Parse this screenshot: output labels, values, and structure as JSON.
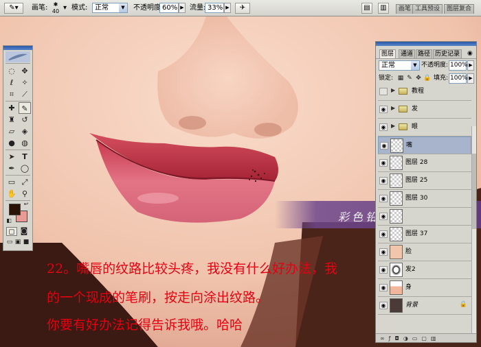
{
  "options_bar": {
    "tool_icon": "brush-icon",
    "brush_label": "画笔:",
    "brush_size": "40",
    "mode_label": "模式:",
    "mode_value": "正常",
    "opacity_label": "不透明度:",
    "opacity_value": "60%",
    "flow_label": "流量:",
    "flow_value": "33%",
    "airbrush_icon": "airbrush-icon",
    "palette_tabs": [
      "画笔",
      "工具预设",
      "图层复合"
    ]
  },
  "layers_panel": {
    "tabs": [
      "图层",
      "通道",
      "路径",
      "历史记录"
    ],
    "blend_mode": "正常",
    "opacity_label": "不透明度:",
    "opacity_value": "100%",
    "lock_label": "锁定:",
    "fill_label": "填充:",
    "fill_value": "100%",
    "layers": [
      {
        "name": "教程",
        "type": "group",
        "visible": false
      },
      {
        "name": "发",
        "type": "group",
        "visible": true
      },
      {
        "name": "眼",
        "type": "group",
        "visible": true
      },
      {
        "name": "嘴",
        "type": "layer",
        "visible": true,
        "selected": true
      },
      {
        "name": "图层 28",
        "type": "layer",
        "visible": true
      },
      {
        "name": "图层 25",
        "type": "layer",
        "visible": true
      },
      {
        "name": "图层 30",
        "type": "layer",
        "visible": true
      },
      {
        "name": "",
        "type": "layer",
        "visible": true
      },
      {
        "name": "图层 37",
        "type": "layer",
        "visible": true
      },
      {
        "name": "脸",
        "type": "layer",
        "visible": true
      },
      {
        "name": "发2",
        "type": "layer",
        "visible": true
      },
      {
        "name": "身",
        "type": "layer",
        "visible": true
      },
      {
        "name": "背景",
        "type": "layer",
        "visible": true,
        "locked": true
      }
    ]
  },
  "banner_text": "彩色铅笔-诗 原创教程",
  "tutorial_text": [
    "22。嘴唇的纹路比较头疼，我没有什么好办法，我",
    "的一个现成的笔刷，按走向涂出纹路。",
    "你要有好办法记得告诉我哦。哈哈"
  ],
  "colors": {
    "foreground": "#2a1408",
    "background": "#e89a94",
    "accent_red": "#e60012",
    "selected_layer": "#a8b3cc"
  }
}
